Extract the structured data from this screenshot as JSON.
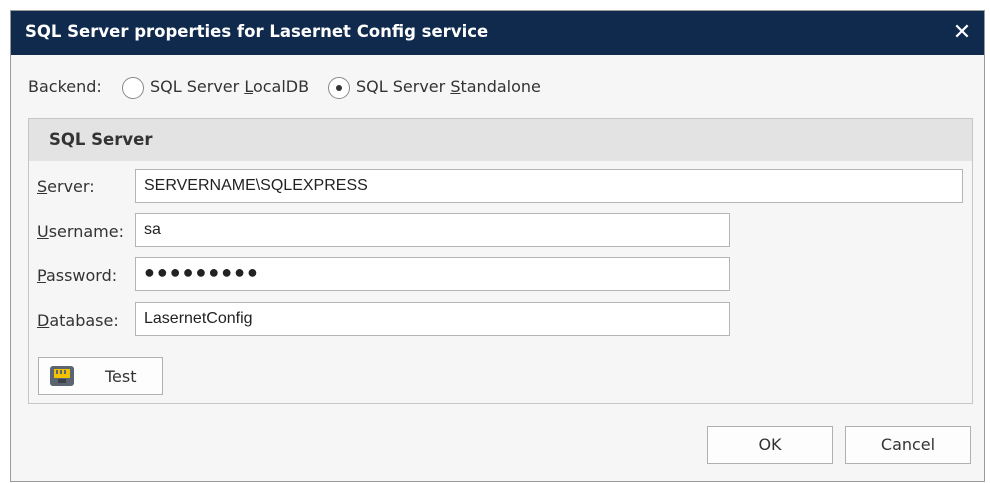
{
  "window": {
    "title": "SQL Server properties for Lasernet Config service",
    "close_glyph": "✕"
  },
  "backend": {
    "label": "Backend:",
    "options": [
      {
        "label_pre": "SQL Server ",
        "label_key": "L",
        "label_post": "ocalDB",
        "selected": false
      },
      {
        "label_pre": "SQL Server ",
        "label_key": "S",
        "label_post": "tandalone",
        "selected": true
      }
    ]
  },
  "sql_server": {
    "title": "SQL Server",
    "server": {
      "label_key": "S",
      "label_rest": "erver:",
      "value": "SERVERNAME\\SQLEXPRESS"
    },
    "username": {
      "label_key": "U",
      "label_rest": "sername:",
      "value": "sa"
    },
    "password": {
      "label_key": "P",
      "label_rest": "assword:",
      "value": "●●●●●●●●●"
    },
    "database": {
      "label_key": "D",
      "label_rest": "atabase:",
      "value": "LasernetConfig"
    },
    "test_button": {
      "label": "Test",
      "icon": "network-port-icon"
    }
  },
  "footer": {
    "ok_label": "OK",
    "cancel_label": "Cancel"
  }
}
